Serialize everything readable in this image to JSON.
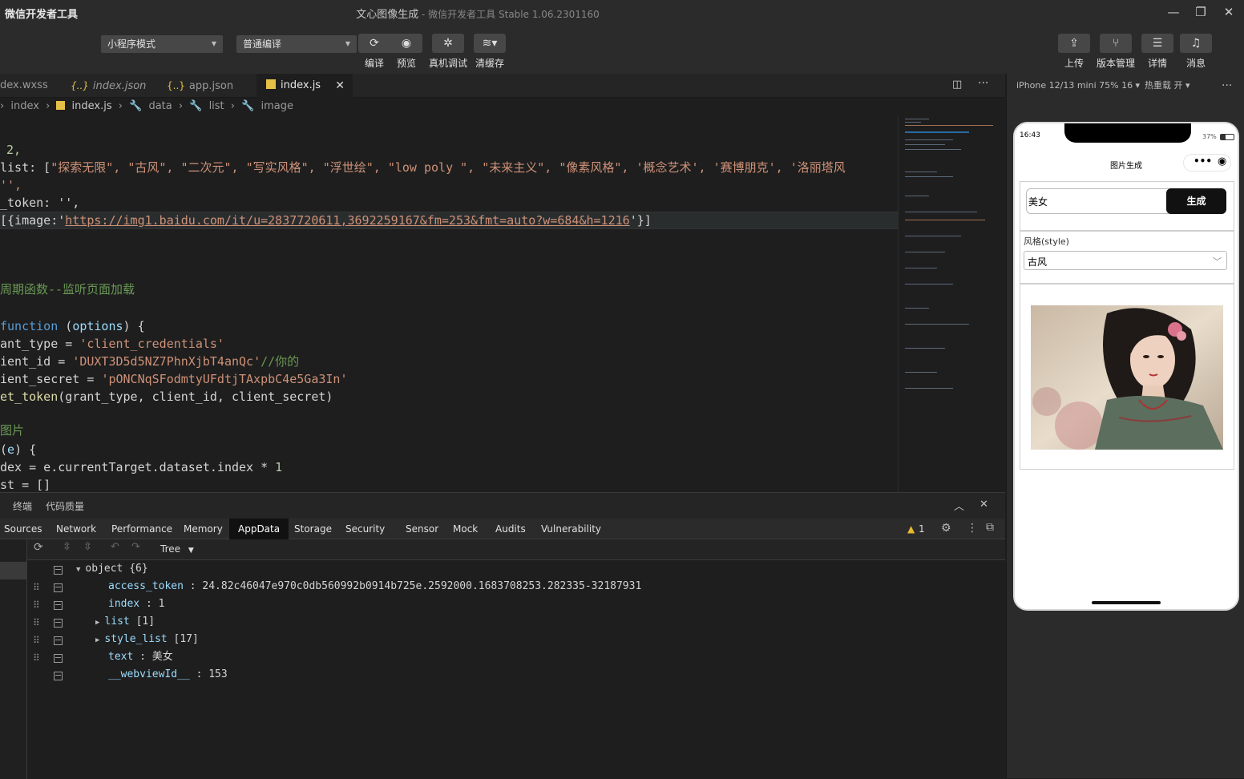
{
  "window": {
    "app_name": "微信开发者工具",
    "project_title": "文心图像生成",
    "subtitle": " - 微信开发者工具 Stable 1.06.2301160",
    "minimize": "—",
    "maximize": "❐",
    "close": "✕"
  },
  "toolbar": {
    "mode_select": "小程序模式",
    "compile_select": "普通编译",
    "buttons": [
      {
        "label": "编译",
        "icon": "refresh-icon"
      },
      {
        "label": "预览",
        "icon": "eye-icon"
      },
      {
        "label": "真机调试",
        "icon": "bug-icon"
      },
      {
        "label": "清缓存",
        "icon": "layers-icon"
      }
    ],
    "right_buttons": [
      {
        "label": "上传",
        "icon": "upload-icon"
      },
      {
        "label": "版本管理",
        "icon": "branch-icon"
      },
      {
        "label": "详情",
        "icon": "menu-icon"
      },
      {
        "label": "消息",
        "icon": "bell-icon"
      }
    ]
  },
  "editor": {
    "tabs": [
      {
        "label": "dex.wxss",
        "type": "wxss"
      },
      {
        "label": "index.json",
        "type": "json"
      },
      {
        "label": "app.json",
        "type": "json"
      },
      {
        "label": "index.js",
        "type": "js"
      }
    ],
    "breadcrumb": [
      "index",
      "index.js",
      "data",
      "list",
      "image"
    ],
    "code": {
      "l1": "2,",
      "l2_key": "list: [",
      "l2_vals": "\"探索无限\", \"古风\", \"二次元\", \"写实风格\", \"浮世绘\", \"low poly \", \"未来主义\", \"像素风格\", '概念艺术', '赛博朋克', '洛丽塔风",
      "l3": "'',",
      "l4": "_token: '',",
      "l5_pre": "[{image:'",
      "l5_url": "https://img1.baidu.com/it/u=2837720611,3692259167&fm=253&fmt=auto?w=684&h=1216",
      "l5_post": "'}]",
      "l6": "周期函数--监听页面加载",
      "l7_kw": "function",
      "l7_arg": "options",
      "l8_var": "ant_type = ",
      "l8_val": "'client_credentials'",
      "l9_var": "ient_id = ",
      "l9_val": "'DUXT3D5d5NZ7PhnXjbT4anQc'",
      "l9_cmt": "//你的",
      "l10_var": "ient_secret = ",
      "l10_val": "'pONCNqSFodmtyUFdtjTAxpbC4e5Ga3In'",
      "l11_fn": "et_token",
      "l11_args": "(grant_type, client_id, client_secret)",
      "l12": "图片",
      "l13_arg": "e",
      "l14": "dex = e.currentTarget.dataset.index * ",
      "l14_num": "1",
      "l15": "st = []"
    }
  },
  "devtools": {
    "header": [
      "终端",
      "代码质量"
    ],
    "tabs": [
      "Sources",
      "Network",
      "Performance",
      "Memory",
      "AppData",
      "Storage",
      "Security",
      "Sensor",
      "Mock",
      "Audits",
      "Vulnerability"
    ],
    "active_tab": "AppData",
    "warning_count": "1",
    "view_mode": "Tree",
    "tree": {
      "root": "object {6}",
      "rows": [
        {
          "key": "access_token",
          "value": "24.82c46047e970c0db560992b0914b725e.2592000.1683708253.282335-32187931"
        },
        {
          "key": "index",
          "value": "1"
        },
        {
          "key": "list",
          "value": "[1]"
        },
        {
          "key": "style_list",
          "value": "[17]"
        },
        {
          "key": "text",
          "value": "美女"
        },
        {
          "key": "__webviewId__",
          "value": "153"
        }
      ]
    }
  },
  "simulator": {
    "device": "iPhone 12/13 mini 75% 16",
    "hot_reload": "热重载 开",
    "status_time": "16:43",
    "battery": "37%",
    "page_title": "图片生成",
    "input_value": "美女",
    "generate_button": "生成",
    "style_label": "风格(style)",
    "style_value": "古风"
  }
}
